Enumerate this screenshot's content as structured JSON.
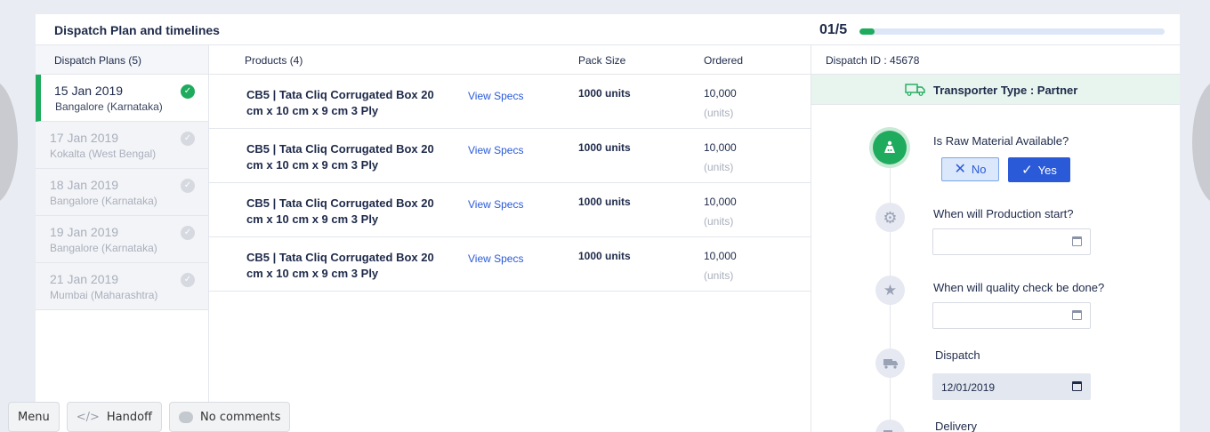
{
  "header": {
    "title": "Dispatch Plan and timelines",
    "progress_text": "01/5",
    "progress_value": 0.2
  },
  "plans": {
    "heading": "Dispatch Plans (5)",
    "items": [
      {
        "date": "15 Jan 2019",
        "location": "Bangalore (Karnataka)"
      },
      {
        "date": "17 Jan 2019",
        "location": "Kokalta (West Bengal)"
      },
      {
        "date": "18 Jan 2019",
        "location": "Bangalore (Karnataka)"
      },
      {
        "date": "19 Jan 2019",
        "location": "Bangalore (Karnataka)"
      },
      {
        "date": "21 Jan 2019",
        "location": "Mumbai (Maharashtra)"
      }
    ]
  },
  "products": {
    "columns": {
      "products": "Products (4)",
      "pack_size": "Pack Size",
      "ordered": "Ordered"
    },
    "rows": [
      {
        "name": "CB5 | Tata Cliq Corrugated Box 20 cm x 10 cm x 9 cm 3 Ply",
        "specs": "View Specs",
        "pack": "1000 units",
        "ordered": "10,000",
        "unit": "(units)"
      },
      {
        "name": "CB5 | Tata Cliq Corrugated Box 20 cm x 10 cm x 9 cm 3 Ply",
        "specs": "View Specs",
        "pack": "1000 units",
        "ordered": "10,000",
        "unit": "(units)"
      },
      {
        "name": "CB5 | Tata Cliq Corrugated Box 20 cm x 10 cm x 9 cm 3 Ply",
        "specs": "View Specs",
        "pack": "1000 units",
        "ordered": "10,000",
        "unit": "(units)"
      },
      {
        "name": "CB5 | Tata Cliq Corrugated Box 20 cm x 10 cm x 9 cm 3 Ply",
        "specs": "View Specs",
        "pack": "1000 units",
        "ordered": "10,000",
        "unit": "(units)"
      }
    ]
  },
  "timeline": {
    "dispatch_id": "Dispatch ID : 45678",
    "transporter": "Transporter Type : Partner",
    "raw_material_q": "Is Raw Material Available?",
    "no_label": "No",
    "yes_label": "Yes",
    "production_q": "When will Production start?",
    "quality_q": "When will quality check be done?",
    "dispatch_label": "Dispatch",
    "dispatch_date": "12/01/2019",
    "delivery_label": "Delivery"
  },
  "bottom": {
    "menu": "Menu",
    "handoff": "Handoff",
    "comments": "No comments"
  },
  "colors": {
    "accent_green": "#1fab5d",
    "accent_blue": "#2a5ad8"
  }
}
